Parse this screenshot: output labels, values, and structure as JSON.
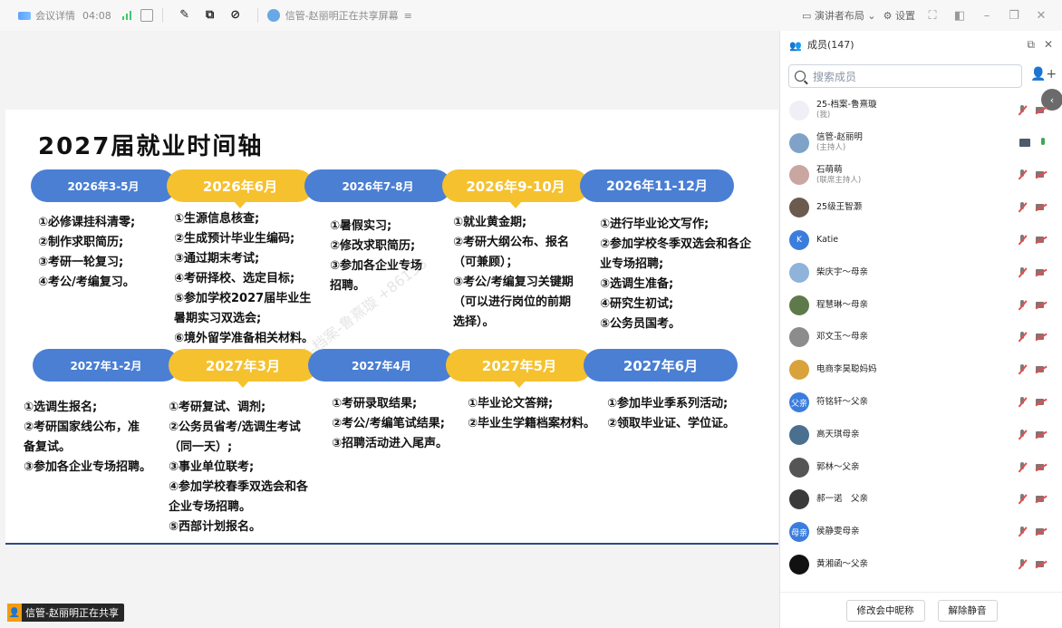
{
  "topbar": {
    "meeting_info": "会议详情",
    "timer": "04:08",
    "sharing_status": "信管-赵丽明正在共享屏幕",
    "speaker_layout": "演讲者布局",
    "settings": "设置"
  },
  "slide": {
    "title": "2027届就业时间轴",
    "watermark": "25-档案-鲁熹璇 +86138",
    "row1": [
      {
        "label": "2026年3-5月",
        "style": "blue",
        "items": "①必修课挂科清零;\n②制作求职简历;\n③考研一轮复习;\n④考公/考编复习。"
      },
      {
        "label": "2026年6月",
        "style": "yellow",
        "items": "①生源信息核查;\n②生成预计毕业生编码;\n③通过期末考试;\n④考研择校、选定目标;\n⑤参加学校2027届毕业生\n暑期实习双选会;\n⑥境外留学准备相关材料。"
      },
      {
        "label": "2026年7-8月",
        "style": "blue",
        "items": "①暑假实习;\n②修改求职简历;\n③参加各企业专场\n招聘。"
      },
      {
        "label": "2026年9-10月",
        "style": "yellow",
        "items": "①就业黄金期;\n②考研大纲公布、报名\n（可兼顾）；\n③考公/考编复习关键期\n（可以进行岗位的前期\n选择）。"
      },
      {
        "label": "2026年11-12月",
        "style": "blue",
        "items": "①进行毕业论文写作;\n②参加学校冬季双选会和各企\n业专场招聘;\n③选调生准备;\n④研究生初试;\n⑤公务员国考。"
      }
    ],
    "row2": [
      {
        "label": "2027年1-2月",
        "style": "blue",
        "items": "①选调生报名;\n②考研国家线公布，准\n备复试。\n③参加各企业专场招聘。"
      },
      {
        "label": "2027年3月",
        "style": "yellow",
        "items": "①考研复试、调剂;\n②公务员省考/选调生考试\n（同一天）;\n③事业单位联考;\n④参加学校春季双选会和各\n企业专场招聘。\n⑤西部计划报名。"
      },
      {
        "label": "2027年4月",
        "style": "blue",
        "items": "①考研录取结果;\n②考公/考编笔试结果;\n③招聘活动进入尾声。"
      },
      {
        "label": "2027年5月",
        "style": "yellow",
        "items": "①毕业论文答辩;\n②毕业生学籍档案材料。"
      },
      {
        "label": "2027年6月",
        "style": "blue",
        "items": "①参加毕业季系列活动;\n②领取毕业证、学位证。"
      }
    ]
  },
  "share_tag": "信管-赵丽明正在共享",
  "panel": {
    "title": "成员(147)",
    "search_placeholder": "搜索成员",
    "members": [
      {
        "name": "25-档案-鲁熹璇",
        "role": "(我)",
        "avatar_color": "#f0eef6",
        "avatar_text": "",
        "status": "muted"
      },
      {
        "name": "信管-赵丽明",
        "role": "(主持人)",
        "avatar_color": "#7fa3c8",
        "avatar_text": "",
        "status": "sharing"
      },
      {
        "name": "石萌萌",
        "role": "(联席主持人)",
        "avatar_color": "#c9a7a0",
        "avatar_text": "",
        "status": "muted"
      },
      {
        "name": "25级王智灏",
        "role": "",
        "avatar_color": "#6b5a4e",
        "avatar_text": "",
        "status": "muted"
      },
      {
        "name": "Katie",
        "role": "",
        "avatar_color": "#3b7ddd",
        "avatar_text": "K",
        "status": "muted"
      },
      {
        "name": "柴庆宇～母亲",
        "role": "",
        "avatar_color": "#8fb3d9",
        "avatar_text": "",
        "status": "muted"
      },
      {
        "name": "程慧琳～母亲",
        "role": "",
        "avatar_color": "#5f7a4a",
        "avatar_text": "",
        "status": "muted"
      },
      {
        "name": "邓文玉～母亲",
        "role": "",
        "avatar_color": "#8c8c8c",
        "avatar_text": "",
        "status": "muted"
      },
      {
        "name": "电商李昊聪妈妈",
        "role": "",
        "avatar_color": "#d9a23a",
        "avatar_text": "",
        "status": "muted"
      },
      {
        "name": "符铭轩～父亲",
        "role": "",
        "avatar_color": "#3b7ddd",
        "avatar_text": "父亲",
        "status": "muted"
      },
      {
        "name": "高天琪母亲",
        "role": "",
        "avatar_color": "#4a6f8f",
        "avatar_text": "",
        "status": "muted"
      },
      {
        "name": "郭林～父亲",
        "role": "",
        "avatar_color": "#555555",
        "avatar_text": "",
        "status": "muted"
      },
      {
        "name": "郝一诺　父亲",
        "role": "",
        "avatar_color": "#3a3a3a",
        "avatar_text": "",
        "status": "muted"
      },
      {
        "name": "侯静雯母亲",
        "role": "",
        "avatar_color": "#3b7ddd",
        "avatar_text": "母亲",
        "status": "muted"
      },
      {
        "name": "黄湘函～父亲",
        "role": "",
        "avatar_color": "#111111",
        "avatar_text": "",
        "status": "muted"
      }
    ],
    "footer": {
      "rename": "修改会中昵称",
      "unmute": "解除静音"
    }
  }
}
